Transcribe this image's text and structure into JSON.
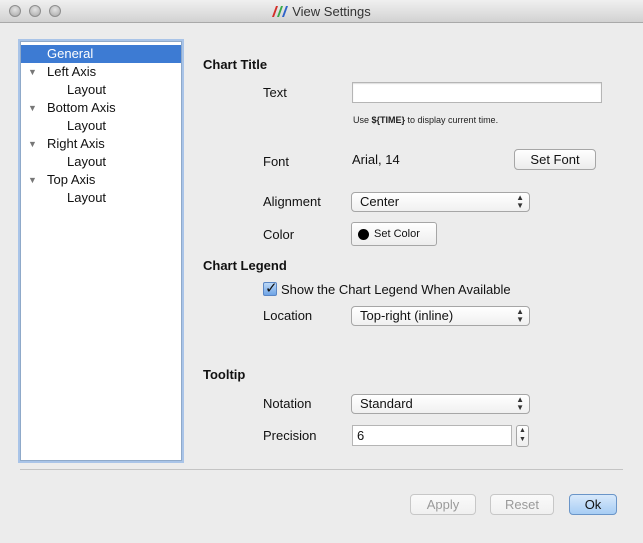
{
  "window": {
    "title": "View Settings"
  },
  "tree": {
    "items": [
      {
        "label": "General",
        "selected": true
      },
      {
        "label": "Left Axis",
        "expanded": true
      },
      {
        "label": "Layout"
      },
      {
        "label": "Bottom Axis",
        "expanded": true
      },
      {
        "label": "Layout"
      },
      {
        "label": "Right Axis",
        "expanded": true
      },
      {
        "label": "Layout"
      },
      {
        "label": "Top Axis",
        "expanded": true
      },
      {
        "label": "Layout"
      }
    ]
  },
  "chart_title": {
    "header": "Chart Title",
    "text_label": "Text",
    "text_value": "",
    "hint_prefix": "Use ",
    "hint_token": "${TIME}",
    "hint_suffix": " to display current time.",
    "font_label": "Font",
    "font_value": "Arial, 14",
    "set_font_label": "Set Font",
    "alignment_label": "Alignment",
    "alignment_value": "Center",
    "color_label": "Color",
    "set_color_label": "Set Color",
    "color_value": "#000000"
  },
  "chart_legend": {
    "header": "Chart Legend",
    "show_label": "Show the Chart Legend When Available",
    "show_checked": true,
    "location_label": "Location",
    "location_value": "Top-right (inline)"
  },
  "tooltip": {
    "header": "Tooltip",
    "notation_label": "Notation",
    "notation_value": "Standard",
    "precision_label": "Precision",
    "precision_value": "6"
  },
  "buttons": {
    "apply": "Apply",
    "reset": "Reset",
    "ok": "Ok"
  },
  "colors": {
    "selection": "#3d7bd3",
    "focus_ring": "#a9c4e8"
  }
}
